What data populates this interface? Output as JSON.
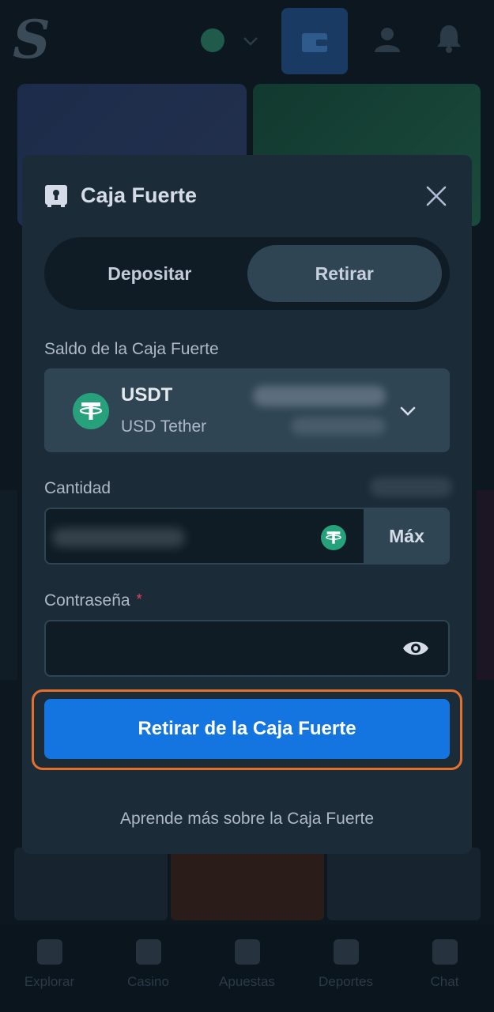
{
  "background": {
    "bottom_nav": [
      {
        "label": "Explorar",
        "icon": "explore-icon"
      },
      {
        "label": "Casino",
        "icon": "casino-icon"
      },
      {
        "label": "Apuestas",
        "icon": "bets-icon"
      },
      {
        "label": "Deportes",
        "icon": "sports-icon"
      },
      {
        "label": "Chat",
        "icon": "chat-icon"
      }
    ]
  },
  "modal": {
    "title": "Caja Fuerte",
    "tabs": [
      {
        "label": "Depositar",
        "active": false
      },
      {
        "label": "Retirar",
        "active": true
      }
    ],
    "balance_label": "Saldo de la Caja Fuerte",
    "currency": {
      "code": "USDT",
      "name": "USD Tether",
      "icon": "tether-icon"
    },
    "amount_label": "Cantidad",
    "max_label": "Máx",
    "password_label": "Contraseña",
    "required_mark": "*",
    "submit_label": "Retirar de la Caja Fuerte",
    "learn_more": "Aprende más sobre la Caja Fuerte"
  },
  "colors": {
    "modal_bg": "#1b2c38",
    "input_bg": "#0f1c25",
    "accent_blue": "#1475e1",
    "highlight_ring": "#e5702e",
    "tether_green": "#26a17b"
  }
}
